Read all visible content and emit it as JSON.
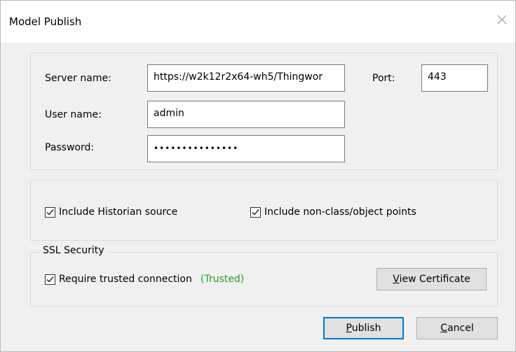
{
  "dialog": {
    "title": "Model Publish"
  },
  "connection": {
    "server_label": "Server name:",
    "server_value": "https://w2k12r2x64-wh5/Thingwor",
    "port_label": "Port:",
    "port_value": "443",
    "user_label": "User name:",
    "user_value": "admin",
    "password_label": "Password:",
    "password_value": "•••••••••••••••"
  },
  "options": {
    "include_historian": {
      "label": "Include Historian source",
      "checked": true
    },
    "include_nonclass": {
      "label": "Include non-class/object points",
      "checked": true
    }
  },
  "ssl": {
    "group_title": "SSL Security",
    "require_trusted": {
      "label": "Require trusted connection",
      "checked": true
    },
    "status": "(Trusted)",
    "status_color": "#2a9d2a",
    "view_cert_first": "V",
    "view_cert_rest": "iew Certificate"
  },
  "buttons": {
    "publish_first": "P",
    "publish_rest": "ublish",
    "cancel_first": "C",
    "cancel_rest": "ancel"
  },
  "colors": {
    "accent": "#0078d7"
  }
}
